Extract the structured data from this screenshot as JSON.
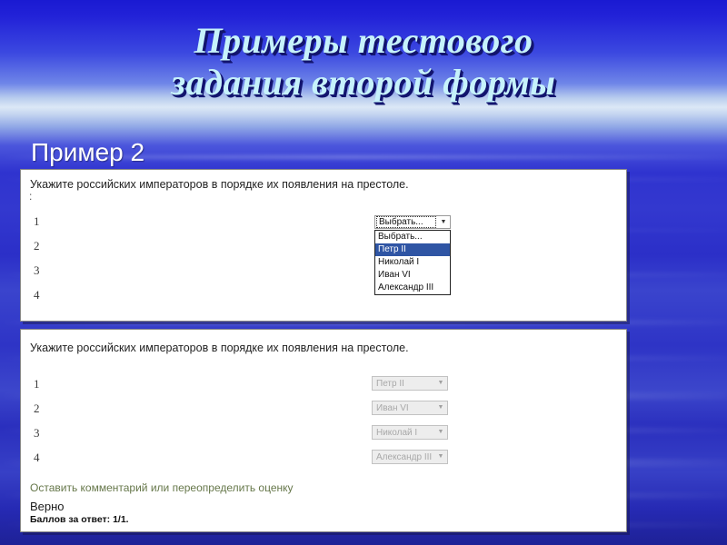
{
  "slide": {
    "title_line1": "Примеры тестового",
    "title_line2": "задания второй формы",
    "subtitle": "Пример 2",
    "title_color": "#c6f2fb",
    "background_color": "#2b2fc8"
  },
  "panel_top": {
    "question": "Укажите российских императоров в порядке их появления на престоле.",
    "colon_artifact": ":",
    "rows": [
      {
        "number": "1"
      },
      {
        "number": "2"
      },
      {
        "number": "3"
      },
      {
        "number": "4"
      }
    ],
    "select": {
      "value": "Выбрать...",
      "arrow_icon": "chevron-down-icon",
      "options": [
        {
          "label": "Выбрать...",
          "selected": false
        },
        {
          "label": "Петр II",
          "selected": true
        },
        {
          "label": "Николай I",
          "selected": false
        },
        {
          "label": "Иван VI",
          "selected": false
        },
        {
          "label": "Александр III",
          "selected": false
        }
      ],
      "highlight_color": "#2f55a4"
    }
  },
  "panel_bottom": {
    "question": "Укажите российских императоров в порядке их появления на престоле.",
    "rows": [
      {
        "number": "1",
        "value": "Петр II"
      },
      {
        "number": "2",
        "value": "Иван VI"
      },
      {
        "number": "3",
        "value": "Николай I"
      },
      {
        "number": "4",
        "value": "Александр III"
      }
    ],
    "arrow_icon": "chevron-down-icon",
    "feedback": {
      "link": "Оставить комментарий или переопределить оценку",
      "link_color": "#66774a",
      "verdict": "Верно",
      "score": "Баллов за ответ: 1/1."
    }
  }
}
